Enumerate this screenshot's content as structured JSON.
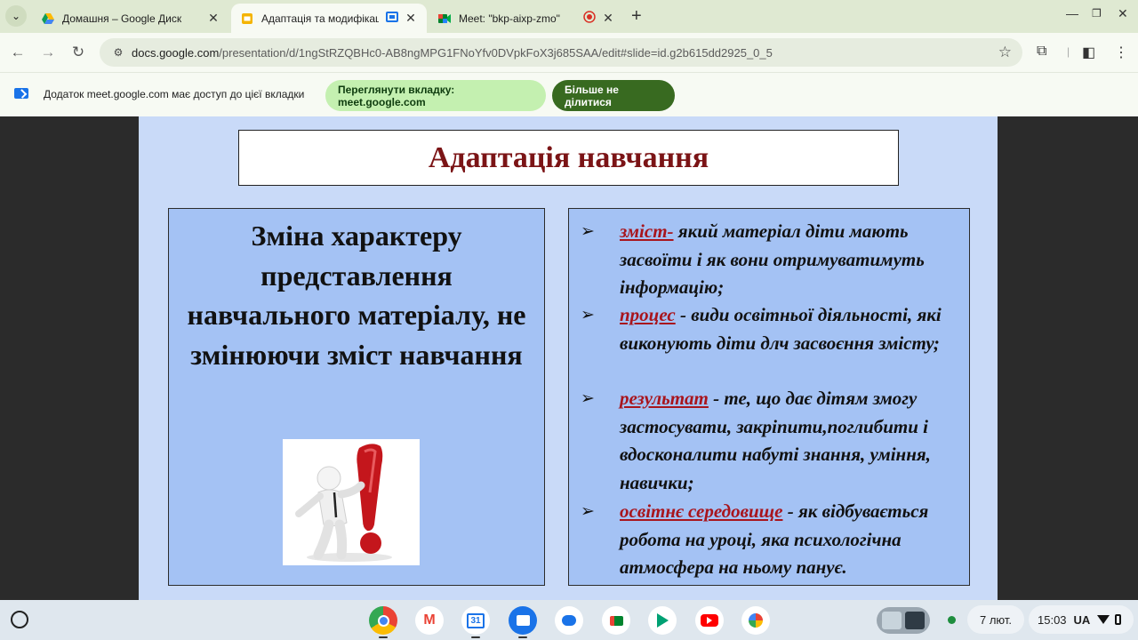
{
  "browser": {
    "tabs": [
      {
        "title": "Домашня – Google Диск",
        "active": false
      },
      {
        "title": "Адаптація та модифікаці",
        "active": true
      },
      {
        "title": "Meet: \"bkp-aixp-zmo\"",
        "active": false
      }
    ],
    "new_tab": "+",
    "url_host": "docs.google.com",
    "url_path": "/presentation/d/1ngStRZQBHc0-AB8ngMPG1FNoYfv0DVpkFoX3j685SAA/edit#slide=id.g2b615dd2925_0_5"
  },
  "sharing_bar": {
    "message": "Додаток meet.google.com має доступ до цієї вкладки",
    "view_button": "Переглянути вкладку: meet.google.com",
    "stop_button": "Більше не ділитися"
  },
  "slide": {
    "title": "Адаптація навчання",
    "left_heading": "Зміна характеру представлення навчального матеріалу, не змінюючи зміст навчання",
    "bullets": [
      {
        "term": "зміст-",
        "text": " який матеріал діти мають засвоїти і як  вони отримуватимуть інформацію;"
      },
      {
        "term": "процес",
        "text": "  - види освітньої діяльності, які виконують діти длч засвоєння змісту;"
      },
      {
        "term": "результат",
        "text": " - те, що дає дітям змогу застосувати, закріпити,поглибити і вдосконалити набуті знання, уміння, навички;"
      },
      {
        "term": "освітнє середовище",
        "text": " - як відбувається робота на уроці, яка психологічна атмосфера на ньому панує."
      }
    ],
    "bullet_symbol": "➢"
  },
  "shelf": {
    "date": "7 лют.",
    "time": "15:03",
    "lang": "UA",
    "apps": [
      "chrome-icon",
      "gmail-icon",
      "calendar-icon",
      "files-icon",
      "chat-icon",
      "meet-icon",
      "play-store-icon",
      "youtube-icon",
      "photos-icon"
    ]
  },
  "colors": {
    "slide_bg": "#c9daf8",
    "box_bg": "#a4c2f4",
    "title_color": "#7b1416",
    "term_color": "#a8151d",
    "stop_button_bg": "#386a20",
    "view_button_bg": "#c4f0b0"
  }
}
